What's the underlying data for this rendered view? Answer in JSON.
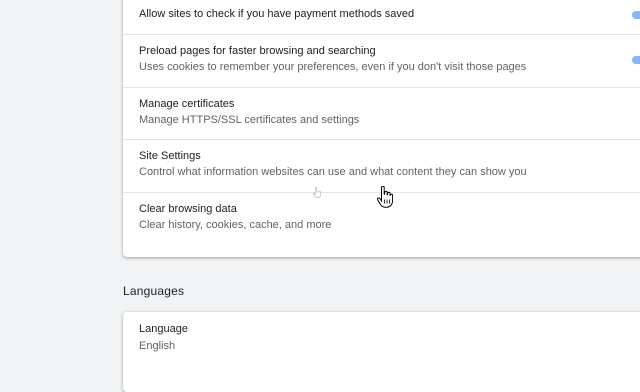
{
  "privacy": {
    "payment_methods": {
      "title": "Allow sites to check if you have payment methods saved",
      "enabled": true
    },
    "preload": {
      "title": "Preload pages for faster browsing and searching",
      "subtitle": "Uses cookies to remember your preferences, even if you don't visit those pages",
      "enabled": true
    },
    "certificates": {
      "title": "Manage certificates",
      "subtitle": "Manage HTTPS/SSL certificates and settings"
    },
    "site_settings": {
      "title": "Site Settings",
      "subtitle": "Control what information websites can use and what content they can show you"
    },
    "clear_data": {
      "title": "Clear browsing data",
      "subtitle": "Clear history, cookies, cache, and more"
    }
  },
  "languages": {
    "heading": "Languages",
    "language": {
      "title": "Language",
      "value": "English"
    }
  },
  "colors": {
    "toggle_on": "#1a73e8",
    "toggle_track": "#8ab4f8"
  },
  "icons": {
    "cursor": "hand-pointer-icon"
  }
}
